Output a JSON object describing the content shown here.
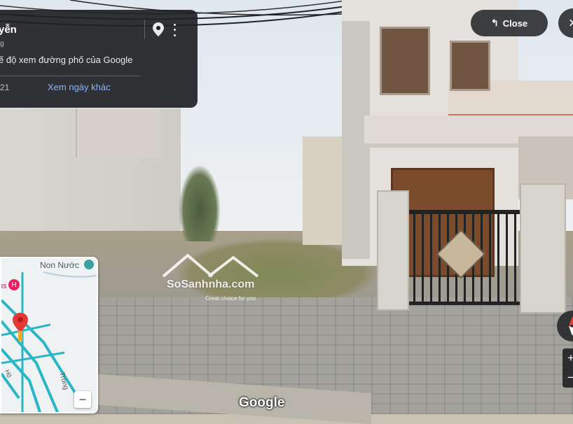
{
  "info_card": {
    "title": "yễn",
    "subtitle": "g",
    "mode_text": "ế độ xem đường phố của Google",
    "date_text": "21",
    "link_text": "Xem ngày khác",
    "pin_icon": "location-pin-icon",
    "more_icon": "more-vert-icon"
  },
  "top_controls": {
    "close_label": "Close",
    "close_icon": "close-icon"
  },
  "minimap": {
    "area_label": "Non Nước",
    "poi_label": "ns",
    "road_label_1": "Hồ",
    "road_label_2": "Trong",
    "zoom_out": "−",
    "pegman_icon": "pegman-icon",
    "hotel_icon": "hotel-icon"
  },
  "right_controls": {
    "compass_icon": "compass-icon",
    "zoom_in": "+",
    "zoom_out": "−"
  },
  "branding": {
    "google_logo": "Google",
    "watermark_name": "SoSanhnha.com",
    "watermark_tagline": "Great choice for you"
  },
  "colors": {
    "panel_bg": "#202124",
    "link": "#8ab4f8",
    "map_road": "#29b6c6",
    "hotel": "#e91e63"
  }
}
